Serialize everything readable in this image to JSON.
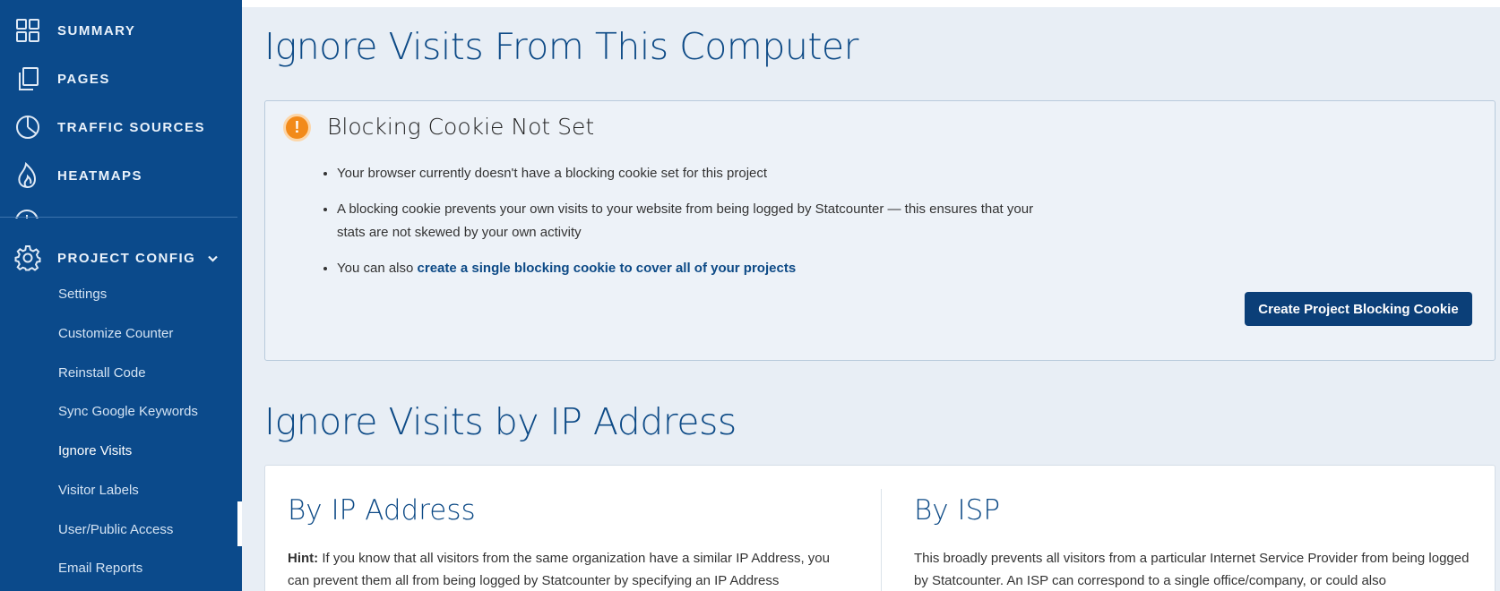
{
  "sidebar": {
    "nav": [
      {
        "label": "SUMMARY",
        "icon": "grid-icon"
      },
      {
        "label": "PAGES",
        "icon": "pages-icon"
      },
      {
        "label": "TRAFFIC SOURCES",
        "icon": "pie-chart-icon"
      },
      {
        "label": "HEATMAPS",
        "icon": "flame-icon"
      }
    ],
    "project_config": {
      "label": "PROJECT CONFIG",
      "icon": "gear-icon",
      "chevron": "chevron-down-icon"
    },
    "sub_items": [
      {
        "label": "Settings"
      },
      {
        "label": "Customize Counter"
      },
      {
        "label": "Reinstall Code"
      },
      {
        "label": "Sync Google Keywords"
      },
      {
        "label": "Ignore Visits"
      },
      {
        "label": "Visitor Labels"
      },
      {
        "label": "User/Public Access"
      },
      {
        "label": "Email Reports"
      }
    ],
    "active_item": "Ignore Visits"
  },
  "main": {
    "section1_title": "Ignore Visits From This Computer",
    "cookie_card": {
      "title": "Blocking Cookie Not Set",
      "bullets": [
        "Your browser currently doesn't have a blocking cookie set for this project",
        "A blocking cookie prevents your own visits to your website from being logged by Statcounter — this ensures that your stats are not skewed by your own activity"
      ],
      "bullet3_prefix": "You can also ",
      "bullet3_link": "create a single blocking cookie to cover all of your projects",
      "button": "Create Project Blocking Cookie"
    },
    "section2_title": "Ignore Visits by IP Address",
    "ip_card": {
      "col1_title": "By IP Address",
      "col1_hint_label": "Hint:",
      "col1_text": " If you know that all visitors from the same organization have a similar IP Address, you can prevent them all from being logged by Statcounter by specifying an IP Address",
      "col2_title": "By ISP",
      "col2_text": "This broadly prevents all visitors from a particular Internet Service Provider from being logged by Statcounter. An ISP can correspond to a single office/company, or could also"
    }
  },
  "colors": {
    "sidebar": "#0b4a8b",
    "accent": "#0d4a86",
    "button": "#0b3f78",
    "warning": "#f28a1a"
  }
}
